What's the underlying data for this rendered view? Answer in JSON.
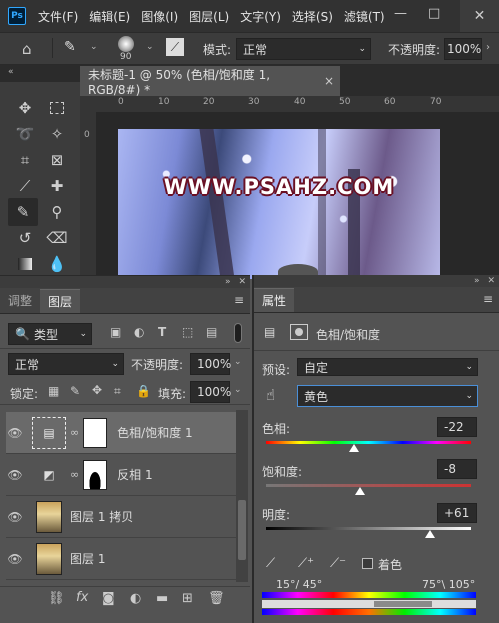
{
  "menubar": {
    "logo": "Ps",
    "items": [
      "文件(F)",
      "编辑(E)",
      "图像(I)",
      "图层(L)",
      "文字(Y)",
      "选择(S)",
      "滤镜(T)"
    ],
    "min": "—",
    "max": "□"
  },
  "options": {
    "brush_size": "90",
    "mode_label": "模式:",
    "mode_value": "正常",
    "opacity_label": "不透明度:",
    "opacity_value": "100%"
  },
  "document": {
    "tab_title": "未标题-1 @ 50% (色相/饱和度 1, RGB/8#) *",
    "close": "×",
    "ruler_h": [
      "0",
      "10",
      "20",
      "30",
      "40",
      "50",
      "60",
      "70"
    ],
    "ruler_v": [
      "0"
    ],
    "watermark": "WWW.PSAHZ.COM"
  },
  "layers_panel": {
    "tabs": [
      "调整",
      "图层"
    ],
    "filter_label": "类型",
    "blend": "正常",
    "opacity_label": "不透明度:",
    "opacity_value": "100%",
    "lock_label": "锁定:",
    "fill_label": "填充:",
    "fill_value": "100%",
    "layers": [
      {
        "name": "色相/饱和度 1"
      },
      {
        "name": "反相 1"
      },
      {
        "name": "图层 1 拷贝"
      },
      {
        "name": "图层 1"
      }
    ],
    "footer_icons": [
      "link-icon",
      "fx-icon",
      "mask-icon",
      "adjustment-icon",
      "group-icon",
      "new-layer-icon",
      "trash-icon"
    ]
  },
  "properties_panel": {
    "title": "属性",
    "header": "色相/饱和度",
    "preset_label": "预设:",
    "preset_value": "自定",
    "channel_value": "黄色",
    "hue_label": "色相:",
    "hue_value": "-22",
    "hue_fraction": 0.43,
    "sat_label": "饱和度:",
    "sat_value": "-8",
    "sat_fraction": 0.46,
    "light_label": "明度:",
    "light_value": "+61",
    "light_fraction": 0.8,
    "colorize_label": "着色",
    "range_left": "15°/ 45°",
    "range_right": "75°\\ 105°"
  }
}
